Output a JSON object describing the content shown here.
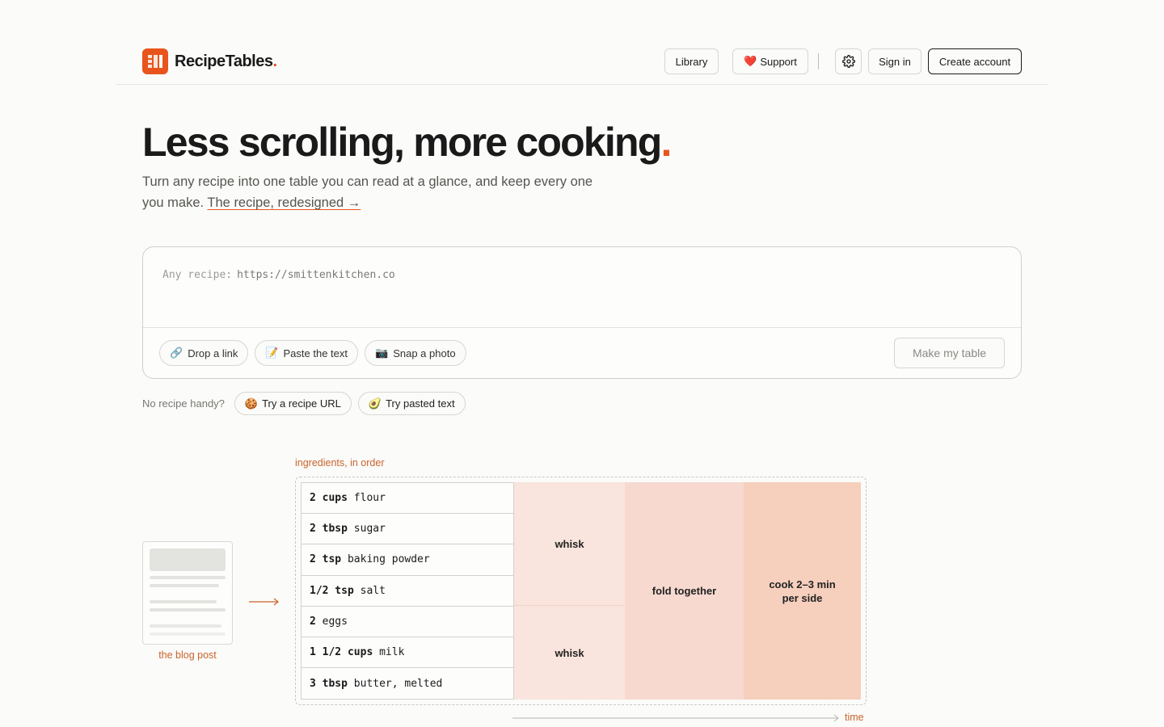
{
  "app": {
    "brand": "RecipeTables",
    "brand_dot": "."
  },
  "nav": {
    "library": "Library",
    "support": "Support",
    "support_icon": "red-heart",
    "settings_icon": "gear-icon",
    "sign_in": "Sign in",
    "create_account": "Create account"
  },
  "hero": {
    "title": "Less scrolling, more cooking",
    "title_dot": ".",
    "subtitle": "Turn any recipe into one table you can read at a glance, and keep every one you make.",
    "link": "The recipe, redesigned →"
  },
  "input": {
    "label": "Any recipe:",
    "value": "https://smittenkitchen.co",
    "modes": [
      {
        "icon": "🔗",
        "label": "Drop a link"
      },
      {
        "icon": "📝",
        "label": "Paste the text"
      },
      {
        "icon": "📷",
        "label": "Snap a photo"
      }
    ],
    "submit": "Make my table"
  },
  "samples": {
    "label": "No recipe handy?",
    "items": [
      {
        "icon": "🍪",
        "label": "Try a recipe URL"
      },
      {
        "icon": "🥑",
        "label": "Try pasted text"
      }
    ]
  },
  "illustration": {
    "blog_caption": "the blog post",
    "ingredients_caption": "ingredients, in order",
    "time_caption": "time",
    "ingredients": [
      {
        "qty": "2 cups",
        "item": " flour"
      },
      {
        "qty": "2 tbsp",
        "item": " sugar"
      },
      {
        "qty": "2 tsp",
        "item": " baking powder"
      },
      {
        "qty": "1/2 tsp",
        "item": " salt"
      },
      {
        "qty": "2",
        "item": " eggs"
      },
      {
        "qty": "1 1/2 cups",
        "item": " milk"
      },
      {
        "qty": "3 tbsp",
        "item": " butter, melted"
      }
    ],
    "steps": {
      "whisk_dry": "whisk",
      "whisk_wet": "whisk",
      "fold": "fold together",
      "cook": "cook 2–3 min per side"
    },
    "colors": {
      "accent": "#e8541c",
      "step1": "#f9e5dd",
      "step2": "#f7d9cf",
      "step3": "#f6cfbd"
    }
  }
}
